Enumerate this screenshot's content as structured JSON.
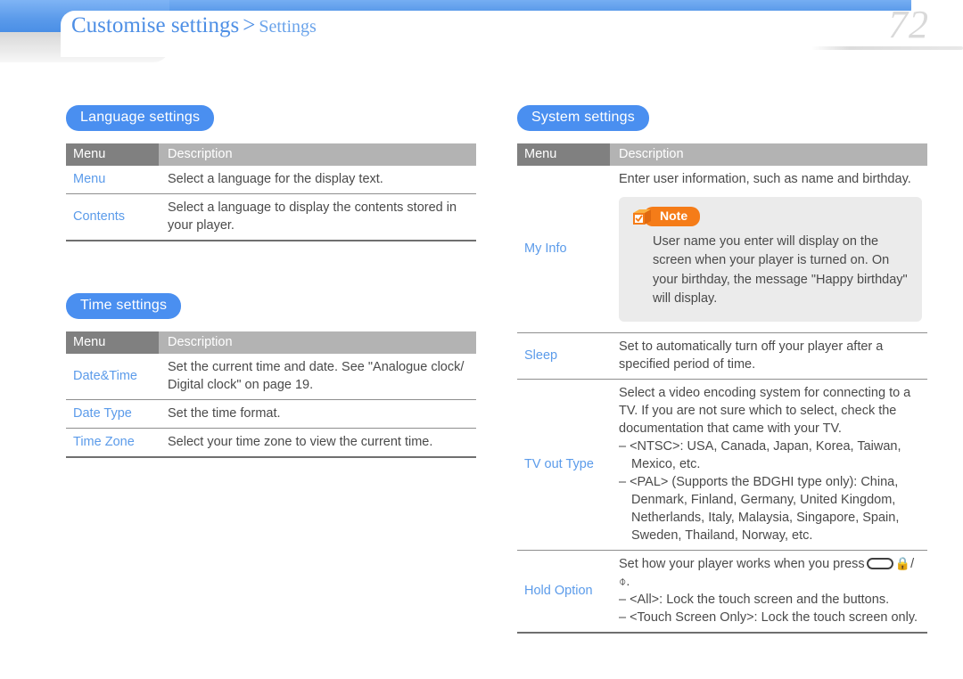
{
  "header": {
    "breadcrumb_main": "Customise settings",
    "breadcrumb_separator": ">",
    "breadcrumb_sub": "Settings",
    "page_number": "72",
    "accent_blue": "#4a8ff0",
    "link_blue": "#5b9bea",
    "note_orange": "#f57c18"
  },
  "left_column": {
    "sections": [
      {
        "title": "Language settings",
        "columns": [
          "Menu",
          "Description"
        ],
        "rows": [
          {
            "menu": "Menu",
            "description": "Select a language for the display text."
          },
          {
            "menu": "Contents",
            "description": "Select a language to display the contents stored in your player."
          }
        ]
      },
      {
        "title": "Time settings",
        "columns": [
          "Menu",
          "Description"
        ],
        "rows": [
          {
            "menu": "Date&Time",
            "description": "Set the current time and date. See \"Analogue clock/ Digital clock\" on page 19."
          },
          {
            "menu": "Date Type",
            "description": "Set the time format."
          },
          {
            "menu": "Time Zone",
            "description": "Select your time zone to view the current time."
          }
        ]
      }
    ]
  },
  "right_column": {
    "section": {
      "title": "System settings",
      "columns": [
        "Menu",
        "Description"
      ],
      "rows": [
        {
          "menu": "My Info",
          "description": "Enter user information, such as name and birthday.",
          "note": {
            "icon": "note-cube-icon",
            "label": "Note",
            "text": "User name you enter will display on the screen when your player is turned on. On your birthday, the message \"Happy birthday\" will display."
          }
        },
        {
          "menu": "Sleep",
          "description": "Set to automatically turn off  your player after a specified period of time."
        },
        {
          "menu": "TV out Type",
          "description": "Select a video encoding system for connecting to a TV. If you are not sure which to select, check the documentation that came with your TV.",
          "bullets": [
            "<NTSC>: USA, Canada, Japan, Korea, Taiwan, Mexico, etc.",
            "<PAL> (Supports the BDGHI type only): China, Denmark, Finland, Germany, United Kingdom, Netherlands, Italy, Malaysia, Singapore, Spain, Sweden, Thailand, Norway, etc."
          ]
        },
        {
          "menu": "Hold Option",
          "description_prefix": "Set how your player works when you press",
          "description_suffix": ".",
          "bullets": [
            "<All>: Lock the touch screen and the buttons.",
            "<Touch Screen Only>: Lock the touch screen only."
          ]
        }
      ]
    }
  }
}
